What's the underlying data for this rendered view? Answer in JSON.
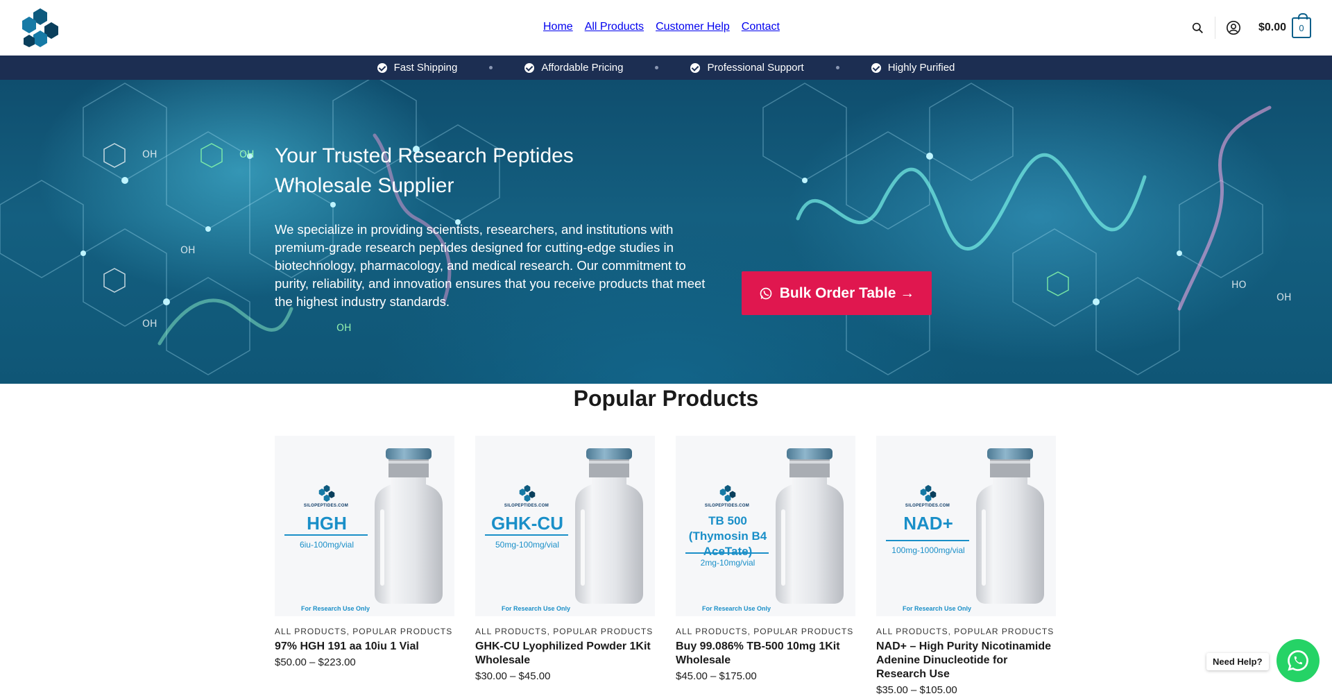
{
  "header": {
    "nav": [
      "Home",
      "All Products",
      "Customer Help",
      "Contact"
    ],
    "cart_total": "$0.00",
    "cart_count": "0",
    "icons": [
      "logo-icon",
      "search-icon",
      "account-icon",
      "cart-icon"
    ]
  },
  "features": [
    "Fast Shipping",
    "Affordable Pricing",
    "Professional Support",
    "Highly Purified"
  ],
  "hero": {
    "title": "Your Trusted Research Peptides Wholesale Supplier",
    "text": "We specialize in providing scientists, researchers, and institutions with premium-grade research peptides designed for cutting-edge studies in biotechnology, pharmacology, and medical research. Our commitment to purity, reliability, and innovation ensures that you receive products that meet the highest industry standards.",
    "button_label": "Bulk Order Table →"
  },
  "popular": {
    "title": "Popular Products",
    "products": [
      {
        "label_brand": "SILOPEPTIDES.COM",
        "label_name": "HGH",
        "label_dose": "6iu-100mg/vial",
        "label_note": "For Research Use Only",
        "categories": "ALL PRODUCTS, POPULAR PRODUCTS",
        "name": "97% HGH 191 aa 10iu 1 Vial",
        "price": "$50.00 – $223.00"
      },
      {
        "label_brand": "SILOPEPTIDES.COM",
        "label_name": "GHK-CU",
        "label_dose": "50mg-100mg/vial",
        "label_note": "For Research Use Only",
        "categories": "ALL PRODUCTS, POPULAR PRODUCTS",
        "name": "GHK-CU Lyophilized Powder 1Kit Wholesale",
        "price": "$30.00 – $45.00"
      },
      {
        "label_brand": "SILOPEPTIDES.COM",
        "label_name": "TB 500 (Thymosin B4 AceTate)",
        "label_dose": "2mg-10mg/vial",
        "label_note": "For Research Use Only",
        "categories": "ALL PRODUCTS, POPULAR PRODUCTS",
        "name": "Buy 99.086% TB-500 10mg 1Kit Wholesale",
        "price": "$45.00 – $175.00"
      },
      {
        "label_brand": "SILOPEPTIDES.COM",
        "label_name": "NAD+",
        "label_dose": "100mg-1000mg/vial",
        "label_note": "For Research Use Only",
        "categories": "ALL PRODUCTS, POPULAR PRODUCTS",
        "name": "NAD+ – High Purity Nicotinamide Adenine Dinucleotide for Research Use",
        "price": "$35.00 – $105.00"
      }
    ]
  },
  "help": {
    "label": "Need Help?",
    "icon": "whatsapp-icon"
  },
  "colors": {
    "feature_bar": "#1c2e52",
    "accent_button": "#e0174f",
    "brand_blue": "#1a8fc8",
    "whatsapp": "#25d366"
  }
}
